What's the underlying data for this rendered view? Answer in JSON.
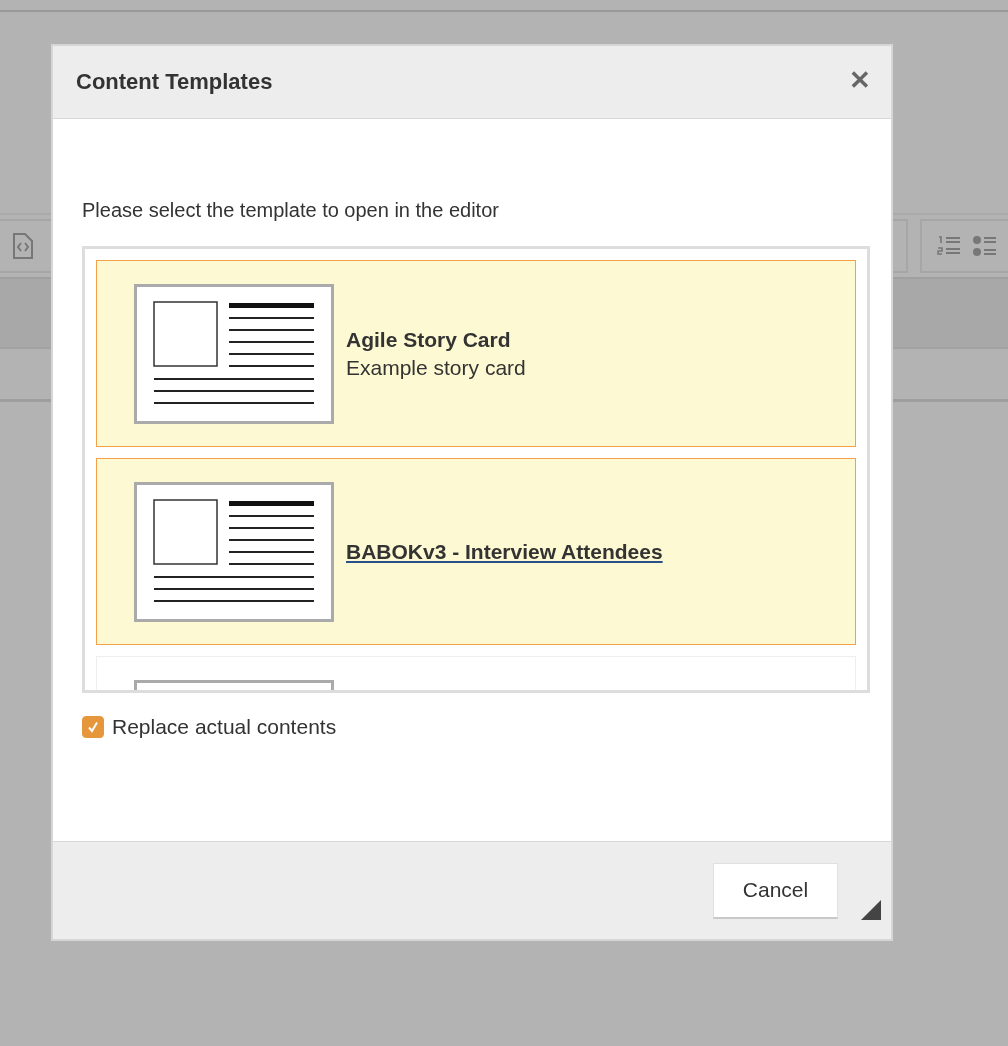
{
  "dialog": {
    "title": "Content Templates",
    "close": "✕",
    "prompt": "Please select the template to open in the editor",
    "templates": [
      {
        "title": "Agile Story Card",
        "description": "Example story card",
        "selected": true,
        "hovered": false
      },
      {
        "title": "BABOKv3 - Interview Attendees",
        "selected": true,
        "hovered": true
      },
      {
        "selected": false
      }
    ],
    "replace": {
      "label": "Replace actual contents",
      "checked": true
    },
    "buttons": [
      "Cancel"
    ]
  }
}
